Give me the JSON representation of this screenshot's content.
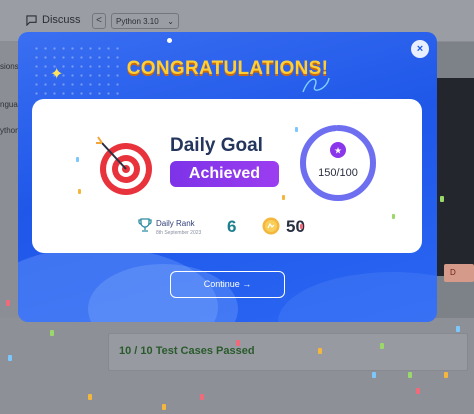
{
  "background": {
    "discuss_label": "Discuss",
    "nav_prev": "<",
    "language_select": "Python 3.10",
    "left_panel_texts": [
      "sions",
      "ngua",
      "ython"
    ],
    "test_cases_text": "10 / 10 Test Cases Passed",
    "right_button_label": "D"
  },
  "modal": {
    "title": "CONGRATULATIONS!",
    "close_label": "×",
    "goal_title": "Daily Goal",
    "achieved_label": "Achieved",
    "progress_text": "150/100",
    "progress_fraction": 1.0,
    "rank_label": "Daily Rank",
    "rank_date": "8th September 2023",
    "rank_value": "6",
    "coins_value": "50",
    "continue_label": "Continue →"
  },
  "colors": {
    "modal_blue": "#2a66f4",
    "title_gold": "#ffcf33",
    "achieved_purple": "#8a37ec",
    "ring_indigo": "#6d6ff0",
    "rank_teal": "#1e7f8e"
  },
  "icons": [
    "discuss-icon",
    "chevron-down-icon",
    "close-icon",
    "target-icon",
    "star-badge-icon",
    "trophy-icon",
    "coin-icon",
    "sparkle-icon"
  ]
}
